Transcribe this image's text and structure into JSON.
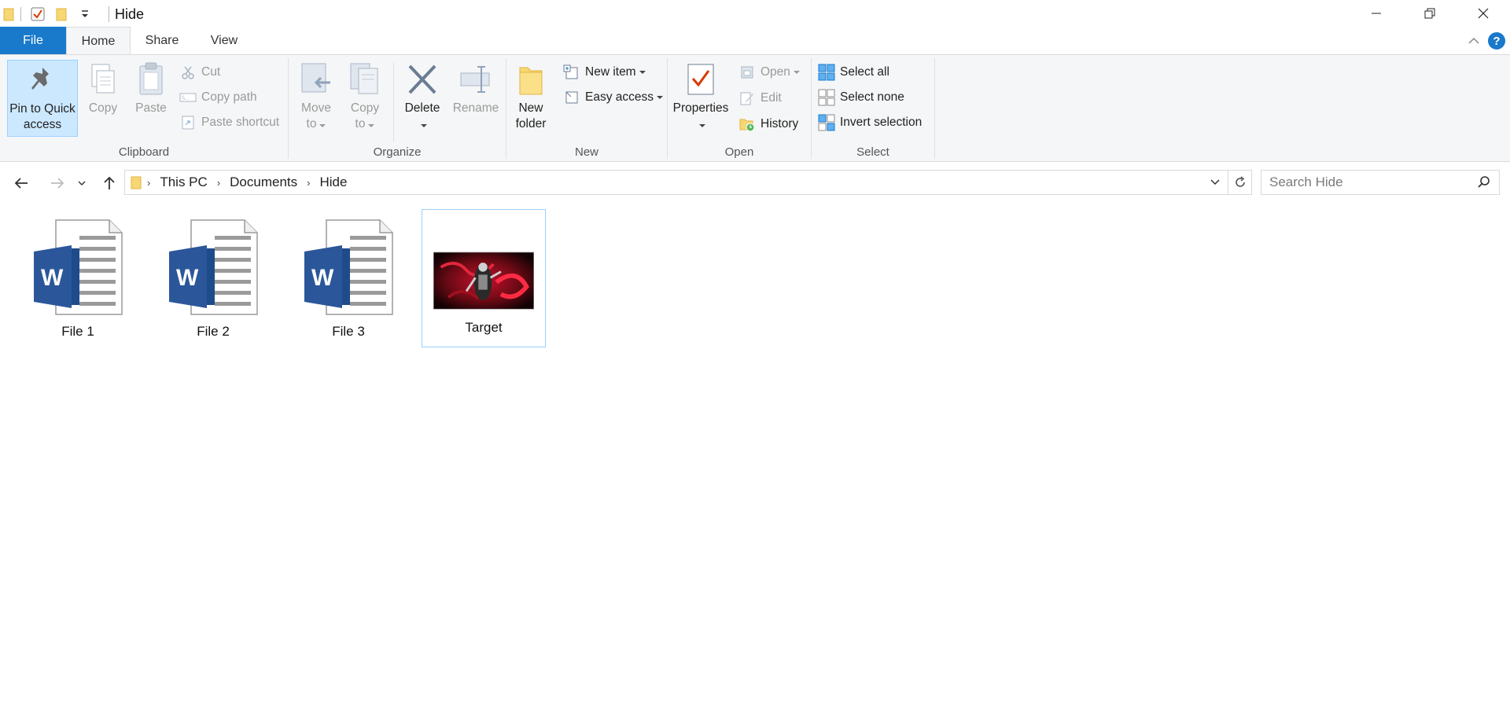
{
  "window": {
    "title": "Hide",
    "controls": {
      "minimize": "minimize",
      "restore": "restore",
      "close": "close"
    }
  },
  "ribbon_tabs": {
    "file": "File",
    "home": "Home",
    "share": "Share",
    "view": "View",
    "help": "?"
  },
  "clipboard": {
    "group_label": "Clipboard",
    "pin_line1": "Pin to Quick",
    "pin_line2": "access",
    "copy": "Copy",
    "paste": "Paste",
    "cut": "Cut",
    "copy_path": "Copy path",
    "paste_shortcut": "Paste shortcut"
  },
  "organize": {
    "group_label": "Organize",
    "move_line1": "Move",
    "move_line2": "to",
    "copy_line1": "Copy",
    "copy_line2": "to",
    "delete": "Delete",
    "rename": "Rename"
  },
  "new": {
    "group_label": "New",
    "new_item": "New item",
    "easy_access": "Easy access",
    "folder_line1": "New",
    "folder_line2": "folder"
  },
  "open": {
    "group_label": "Open",
    "properties": "Properties",
    "open": "Open",
    "edit": "Edit",
    "history": "History"
  },
  "select": {
    "group_label": "Select",
    "select_all": "Select all",
    "select_none": "Select none",
    "invert_selection": "Invert selection"
  },
  "address": {
    "breadcrumbs": [
      "This PC",
      "Documents",
      "Hide"
    ]
  },
  "search": {
    "placeholder": "Search Hide"
  },
  "files": [
    {
      "name": "File 1",
      "type": "word-document-icon"
    },
    {
      "name": "File 2",
      "type": "word-document-icon"
    },
    {
      "name": "File 3",
      "type": "word-document-icon"
    },
    {
      "name": "Target",
      "type": "image-thumbnail",
      "selected": true
    }
  ],
  "colors": {
    "file_tab": "#1979ca",
    "word_blue": "#2b579a",
    "selection_border": "#99d1ff",
    "selection_fill": "#cce8ff",
    "ribbon_bg": "#f5f6f7"
  }
}
